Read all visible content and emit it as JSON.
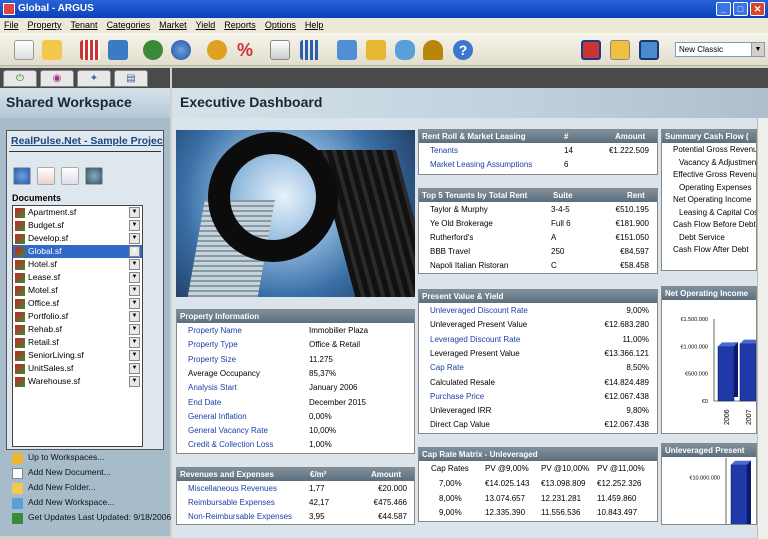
{
  "window": {
    "title": "Global - ARGUS"
  },
  "menu": [
    "File",
    "Property",
    "Tenant",
    "Categories",
    "Market",
    "Yield",
    "Reports",
    "Options",
    "Help"
  ],
  "toolbar": {
    "skin_select": "New Classic"
  },
  "left": {
    "header": "Shared Workspace",
    "project_title": "RealPulse.Net - Sample Project",
    "documents_label": "Documents",
    "documents": [
      "Apartment.sf",
      "Budget.sf",
      "Develop.sf",
      "Global.sf",
      "Hotel.sf",
      "Lease.sf",
      "Motel.sf",
      "Office.sf",
      "Portfolio.sf",
      "Rehab.sf",
      "Retail.sf",
      "SeniorLiving.sf",
      "UnitSales.sf",
      "Warehouse.sf"
    ],
    "selected_document": "Global.sf",
    "links": [
      "Up to Workspaces...",
      "Add New Document...",
      "Add New Folder...",
      "Add New Workspace...",
      "Get Updates   Last Updated: 9/18/2006"
    ]
  },
  "dashboard": {
    "title": "Executive Dashboard",
    "rent_roll": {
      "title": "Rent Roll & Market Leasing",
      "col_count": "#",
      "col_amount": "Amount",
      "rows": [
        {
          "label": "Tenants",
          "count": "14",
          "amount": "€1.222.509"
        },
        {
          "label": "Market Leasing Assumptions",
          "count": "6",
          "amount": ""
        }
      ]
    },
    "top_tenants": {
      "title": "Top 5 Tenants by Total Rent",
      "col_suite": "Suite",
      "col_rent": "Rent",
      "rows": [
        {
          "name": "Taylor & Murphy",
          "suite": "3-4-5",
          "rent": "€510.195"
        },
        {
          "name": "Ye Old Brokerage",
          "suite": "Full 6",
          "rent": "€181.900"
        },
        {
          "name": "Rutherford's",
          "suite": "A",
          "rent": "€151.050"
        },
        {
          "name": "BBB Travel",
          "suite": "250",
          "rent": "€84.597"
        },
        {
          "name": "Napoli Italian Ristoran",
          "suite": "C",
          "rent": "€58.458"
        }
      ]
    },
    "summary_cf": {
      "title": "Summary Cash Flow (",
      "rows": [
        "Potential Gross Revenue",
        "Vacancy & Adjustments",
        "Effective Gross Revenue",
        "Operating Expenses",
        "Net Operating Income",
        "Leasing & Capital Costs",
        "Cash Flow Before Debt",
        "Debt Service",
        "Cash Flow After Debt"
      ]
    },
    "property_info": {
      "title": "Property Information",
      "rows": [
        {
          "label": "Property Name",
          "value": "Immobilier Plaza"
        },
        {
          "label": "Property Type",
          "value": "Office & Retail"
        },
        {
          "label": "Property Size",
          "value": "11.275"
        },
        {
          "label": "Average Occupancy",
          "value": "85,37%"
        },
        {
          "label": "Analysis Start",
          "value": "January 2006"
        },
        {
          "label": "End Date",
          "value": "December 2015"
        },
        {
          "label": "General Inflation",
          "value": "0,00%"
        },
        {
          "label": "General Vacancy Rate",
          "value": "10,00%"
        },
        {
          "label": "Credit & Collection Loss",
          "value": "1,00%"
        }
      ]
    },
    "pv_yield": {
      "title": "Present Value & Yield",
      "rows": [
        {
          "label": "Unleveraged Discount Rate",
          "value": "9,00%"
        },
        {
          "label": "Unleveraged Present Value",
          "value": "€12.683.280"
        },
        {
          "label": "Leveraged Discount Rate",
          "value": "11,00%"
        },
        {
          "label": "Leveraged Present Value",
          "value": "€13.366.121"
        },
        {
          "label": "Cap Rate",
          "value": "8,50%"
        },
        {
          "label": "Calculated Resale",
          "value": "€14.824.489"
        },
        {
          "label": "Purchase Price",
          "value": "€12.067.438"
        },
        {
          "label": "Unleveraged IRR",
          "value": "9,80%"
        },
        {
          "label": "Direct Cap Value",
          "value": "€12.067.438"
        }
      ]
    },
    "revenues": {
      "title": "Revenues and Expenses",
      "col_m2": "€/m²",
      "col_amount": "Amount",
      "rows": [
        {
          "label": "Miscellaneous Revenues",
          "m2": "1,77",
          "amount": "€20.000"
        },
        {
          "label": "Reimbursable Expenses",
          "m2": "42,17",
          "amount": "€475.466"
        },
        {
          "label": "Non-Reimbursable Expenses",
          "m2": "3,95",
          "amount": "€44.587"
        }
      ]
    },
    "cap_matrix": {
      "title": "Cap Rate Matrix - Unleveraged",
      "headers": [
        "Cap Rates",
        "PV @9,00%",
        "PV @10,00%",
        "PV @11,00%"
      ],
      "rows": [
        [
          "7,00%",
          "€14.025.143",
          "€13.098.809",
          "€12.252.326"
        ],
        [
          "8,00%",
          "13.074.657",
          "12.231.281",
          "11.459.860"
        ],
        [
          "9,00%",
          "12.335.390",
          "11.556.536",
          "10.843.497"
        ]
      ]
    },
    "noi_chart": {
      "title": "Net Operating Income",
      "yticks": [
        "€1.500.000",
        "€1.000.000",
        "€500.000",
        "€0"
      ],
      "xticks": [
        "2006",
        "2007"
      ]
    },
    "upv_chart": {
      "title": "Unleveraged Present",
      "yticks": [
        "€15.000.000",
        "€10.000.000"
      ]
    }
  },
  "chart_data": [
    {
      "type": "bar",
      "title": "Net Operating Income",
      "categories": [
        "2006",
        "2007"
      ],
      "values": [
        1000000,
        1050000
      ],
      "ylim": [
        0,
        1500000
      ]
    },
    {
      "type": "bar",
      "title": "Unleveraged Present",
      "categories": [
        ""
      ],
      "values": [
        12683280
      ],
      "ylim": [
        0,
        15000000
      ]
    }
  ]
}
